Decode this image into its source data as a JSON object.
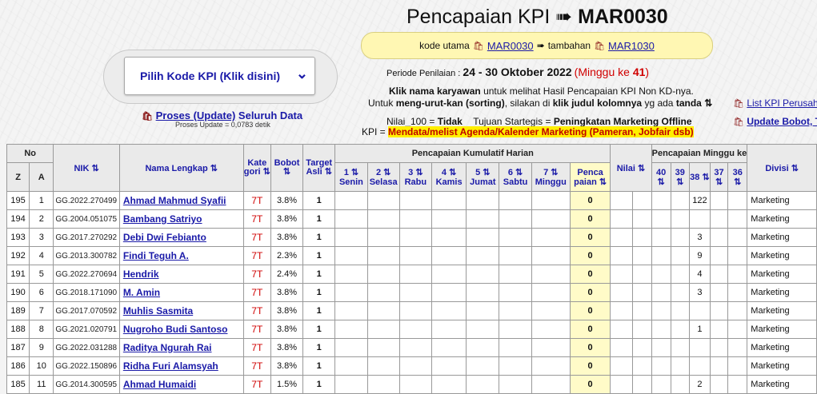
{
  "header": {
    "title_prefix": "Pencapaian KPI",
    "arrow": "➠",
    "title_code": "MAR0030",
    "kode_utama_label": "kode utama",
    "kode_utama": "MAR0030",
    "tambahan_label": "tambahan",
    "tambahan": "MAR1030",
    "bag_icon": "🛍"
  },
  "selector": {
    "label": "Pilih Kode KPI (Klik disini)",
    "chevron": "⌄"
  },
  "proses": {
    "link": "Proses (Update)",
    "rest": "Seluruh Data",
    "sub": "Proses Update = 0,0783 detik"
  },
  "periode": {
    "label": "Periode Penilaian",
    "range": "24 - 30 Oktober 2022",
    "minggu_prefix": "(Minggu ke ",
    "minggu_num": "41",
    "minggu_suffix": ")"
  },
  "info": {
    "klik_bold": "Klik nama karyawan",
    "klik_rest": "untuk melihat Hasil Pencapaian KPI Non KD-nya.",
    "urut_pre": "Untuk",
    "urut_bold": "meng-urut-kan (sorting)",
    "urut_mid": ", silakan di",
    "urut_bold2": "klik judul kolomnya",
    "urut_post": "yg ada",
    "urut_bold3": "tanda",
    "sort_icon": "⇅",
    "nilai_label": "Nilai_100 =",
    "nilai_val": "Tidak",
    "tujuan_label": "Tujuan Startegis =",
    "tujuan_val": "Peningkatan Marketing Offline",
    "kpi_label": "KPI =",
    "kpi_val": "Mendata/melist Agenda/Kalender Marketing (Pameran, Jobfair dsb)"
  },
  "right_links": {
    "list": "List KPI Perusaha",
    "update": "Update Bobot, T"
  },
  "table": {
    "h_no": "No",
    "h_z": "Z",
    "h_a": "A",
    "h_nik": "NIK ⇅",
    "h_nama": "Nama Lengkap ⇅",
    "h_kat": "Kate gori ⇅",
    "h_bobot": "Bobot ⇅",
    "h_target": "Target Asli ⇅",
    "h_harian": "Pencapaian Kumulatif Harian",
    "days": [
      "1 ⇅ Senin",
      "2 ⇅ Selasa",
      "3 ⇅ Rabu",
      "4 ⇅ Kamis",
      "5 ⇅ Jumat",
      "6 ⇅ Sabtu",
      "7 ⇅ Minggu"
    ],
    "h_penca": "Penca paian ⇅",
    "h_nilai": "Nilai ⇅",
    "h_minggu": "Pencapaian Minggu ke",
    "weeks": [
      "40 ⇅",
      "39 ⇅",
      "38 ⇅",
      "37 ⇅",
      "36 ⇅"
    ],
    "h_divisi": "Divisi ⇅",
    "rows": [
      {
        "z": "195",
        "a": "1",
        "nik": "GG.2022.270499",
        "nama": "Ahmad Mahmud Syafii",
        "kat": "7T",
        "bobot": "3.8%",
        "target": "1",
        "penca": "0",
        "w38": "122",
        "divisi": "Marketing"
      },
      {
        "z": "194",
        "a": "2",
        "nik": "GG.2004.051075",
        "nama": "Bambang Satriyo",
        "kat": "7T",
        "bobot": "3.8%",
        "target": "1",
        "penca": "0",
        "w38": "",
        "divisi": "Marketing"
      },
      {
        "z": "193",
        "a": "3",
        "nik": "GG.2017.270292",
        "nama": "Debi Dwi Febianto",
        "kat": "7T",
        "bobot": "3.8%",
        "target": "1",
        "penca": "0",
        "w38": "3",
        "divisi": "Marketing"
      },
      {
        "z": "192",
        "a": "4",
        "nik": "GG.2013.300782",
        "nama": "Findi Teguh A.",
        "kat": "7T",
        "bobot": "2.3%",
        "target": "1",
        "penca": "0",
        "w38": "9",
        "divisi": "Marketing"
      },
      {
        "z": "191",
        "a": "5",
        "nik": "GG.2022.270694",
        "nama": "Hendrik",
        "kat": "7T",
        "bobot": "2.4%",
        "target": "1",
        "penca": "0",
        "w38": "4",
        "divisi": "Marketing"
      },
      {
        "z": "190",
        "a": "6",
        "nik": "GG.2018.171090",
        "nama": "M. Amin",
        "kat": "7T",
        "bobot": "3.8%",
        "target": "1",
        "penca": "0",
        "w38": "3",
        "divisi": "Marketing"
      },
      {
        "z": "189",
        "a": "7",
        "nik": "GG.2017.070592",
        "nama": "Muhlis Sasmita",
        "kat": "7T",
        "bobot": "3.8%",
        "target": "1",
        "penca": "0",
        "w38": "",
        "divisi": "Marketing"
      },
      {
        "z": "188",
        "a": "8",
        "nik": "GG.2021.020791",
        "nama": "Nugroho Budi Santoso",
        "kat": "7T",
        "bobot": "3.8%",
        "target": "1",
        "penca": "0",
        "w38": "1",
        "divisi": "Marketing"
      },
      {
        "z": "187",
        "a": "9",
        "nik": "GG.2022.031288",
        "nama": "Raditya Ngurah Rai",
        "kat": "7T",
        "bobot": "3.8%",
        "target": "1",
        "penca": "0",
        "w38": "",
        "divisi": "Marketing"
      },
      {
        "z": "186",
        "a": "10",
        "nik": "GG.2022.150896",
        "nama": "Ridha Furi Alamsyah",
        "kat": "7T",
        "bobot": "3.8%",
        "target": "1",
        "penca": "0",
        "w38": "",
        "divisi": "Marketing"
      },
      {
        "z": "185",
        "a": "11",
        "nik": "GG.2014.300595",
        "nama": "Ahmad Humaidi",
        "kat": "7T",
        "bobot": "1.5%",
        "target": "1",
        "penca": "0",
        "w38": "2",
        "divisi": "Marketing"
      }
    ]
  },
  "colors": {
    "link": "#1a1aa8",
    "accent_red": "#d00000",
    "highlight": "#ffef00",
    "pencapaian_bg": "#fffbc8"
  }
}
